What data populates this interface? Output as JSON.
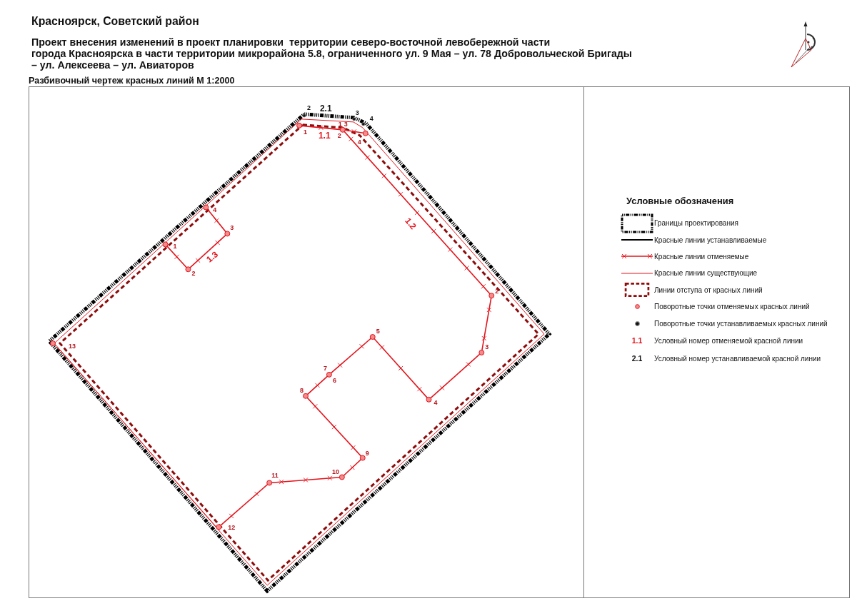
{
  "header": {
    "location": "Красноярск, Советский район",
    "title_lines": [
      "Проект внесения изменений в проект планировки  территории северо-восточной левобережной части",
      "города Красноярска в части территории микрорайона 5.8, ограниченного ул. 9 Мая – ул. 78 Добровольческой Бригады",
      "– ул. Алексеева – ул. Авиаторов"
    ],
    "subtitle": "Разбивочный чертеж красных линий М 1:2000"
  },
  "map": {
    "labels": [
      {
        "text": "2",
        "kind": "established_point"
      },
      {
        "text": "2.1",
        "kind": "established_line"
      },
      {
        "text": "3",
        "kind": "established_point"
      },
      {
        "text": "4",
        "kind": "established_point"
      },
      {
        "text": "1",
        "kind": "cancelled_point"
      },
      {
        "text": "3",
        "kind": "cancelled_point"
      },
      {
        "text": "1",
        "kind": "cancelled_point"
      },
      {
        "text": "1.1",
        "kind": "cancelled_line"
      },
      {
        "text": "2",
        "kind": "cancelled_point"
      },
      {
        "text": "4",
        "kind": "cancelled_point"
      },
      {
        "text": "4",
        "kind": "cancelled_point"
      },
      {
        "text": "1.2",
        "kind": "cancelled_line"
      },
      {
        "text": "3",
        "kind": "cancelled_point"
      },
      {
        "text": "1",
        "kind": "cancelled_point"
      },
      {
        "text": "1.3",
        "kind": "cancelled_line"
      },
      {
        "text": "2",
        "kind": "cancelled_point"
      },
      {
        "text": "2",
        "kind": "cancelled_point"
      },
      {
        "text": "5",
        "kind": "cancelled_point"
      },
      {
        "text": "13",
        "kind": "cancelled_point"
      },
      {
        "text": "3",
        "kind": "cancelled_point"
      },
      {
        "text": "7",
        "kind": "cancelled_point"
      },
      {
        "text": "6",
        "kind": "cancelled_point"
      },
      {
        "text": "8",
        "kind": "cancelled_point"
      },
      {
        "text": "4",
        "kind": "cancelled_point"
      },
      {
        "text": "9",
        "kind": "cancelled_point"
      },
      {
        "text": "11",
        "kind": "cancelled_point"
      },
      {
        "text": "10",
        "kind": "cancelled_point"
      },
      {
        "text": "12",
        "kind": "cancelled_point"
      }
    ]
  },
  "legend": {
    "title": "Условные обозначения",
    "items": [
      {
        "kind": "boundary",
        "label": "Границы проектирования"
      },
      {
        "kind": "established_line",
        "label": "Красные линии устанавливаемые"
      },
      {
        "kind": "cancelled_line",
        "label": "Красные линии отменяемые"
      },
      {
        "kind": "existing_line",
        "label": "Красные линии существующие"
      },
      {
        "kind": "setback_line",
        "label": "Линии отступа от красных линий"
      },
      {
        "kind": "cancelled_point",
        "label": "Поворотные точки отменяемых красных линий"
      },
      {
        "kind": "established_point",
        "label": "Поворотные точки устанавливаемых красных линий"
      },
      {
        "kind": "cancelled_number",
        "symbol": "1.1",
        "label": "Условный номер отменяемой красной линии"
      },
      {
        "kind": "established_number",
        "symbol": "2.1",
        "label": "Условный номер устанавливаемой красной линии"
      }
    ]
  }
}
